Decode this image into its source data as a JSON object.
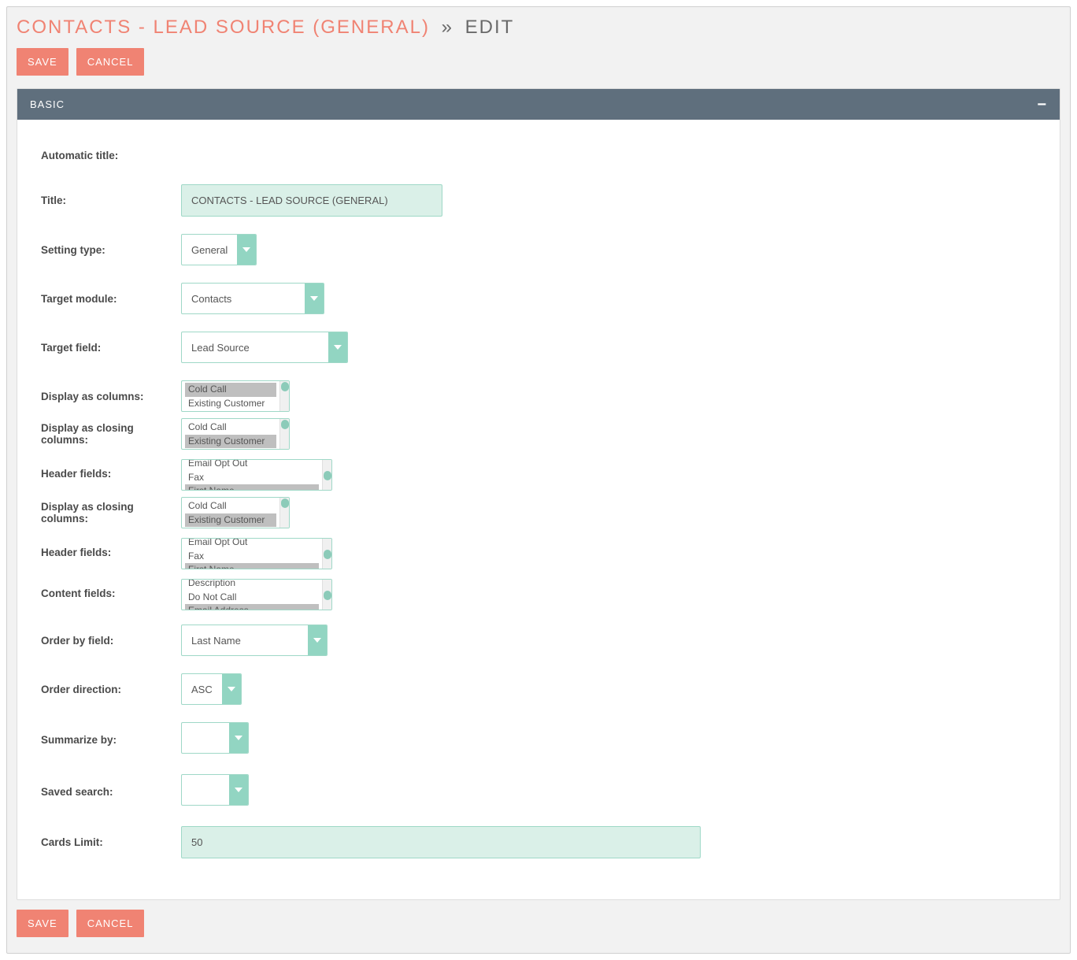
{
  "title_first": "CONTACTS - LEAD SOURCE (GENERAL)",
  "title_sep": "»",
  "title_second": "EDIT",
  "buttons": {
    "save": "SAVE",
    "cancel": "CANCEL"
  },
  "panel": {
    "title": "BASIC",
    "fields": {
      "automatic_title_label": "Automatic title:",
      "title_label": "Title:",
      "title_value": "CONTACTS - LEAD SOURCE (GENERAL)",
      "setting_type_label": "Setting type:",
      "setting_type_value": "General",
      "target_module_label": "Target module:",
      "target_module_value": "Contacts",
      "target_field_label": "Target field:",
      "target_field_value": "Lead Source",
      "display_columns_label": "Display as columns:",
      "display_columns_items": [
        {
          "text": "Cold Call",
          "sel": true
        },
        {
          "text": "Existing Customer",
          "sel": false
        }
      ],
      "display_closing_label": "Display as closing columns:",
      "display_closing_items": [
        {
          "text": "Cold Call",
          "sel": false
        },
        {
          "text": "Existing Customer",
          "sel": true
        }
      ],
      "header_fields_label": "Header fields:",
      "header_fields_items": [
        {
          "text": "Email Opt Out",
          "sel": false
        },
        {
          "text": "Fax",
          "sel": false
        },
        {
          "text": "First Name",
          "sel": true
        }
      ],
      "display_closing2_label": "Display as closing columns:",
      "display_closing2_items": [
        {
          "text": "Cold Call",
          "sel": false
        },
        {
          "text": "Existing Customer",
          "sel": true
        }
      ],
      "header_fields2_label": "Header fields:",
      "header_fields2_items": [
        {
          "text": "Email Opt Out",
          "sel": false
        },
        {
          "text": "Fax",
          "sel": false
        },
        {
          "text": "First Name",
          "sel": true
        }
      ],
      "content_fields_label": "Content fields:",
      "content_fields_items": [
        {
          "text": "Description",
          "sel": false
        },
        {
          "text": "Do Not Call",
          "sel": false
        },
        {
          "text": "Email Address",
          "sel": true
        }
      ],
      "order_by_label": "Order by field:",
      "order_by_value": "Last Name",
      "order_direction_label": "Order direction:",
      "order_direction_value": "ASC",
      "summarize_label": "Summarize by:",
      "summarize_value": "",
      "saved_search_label": "Saved search:",
      "saved_search_value": "",
      "cards_limit_label": "Cards Limit:",
      "cards_limit_value": "50"
    }
  }
}
